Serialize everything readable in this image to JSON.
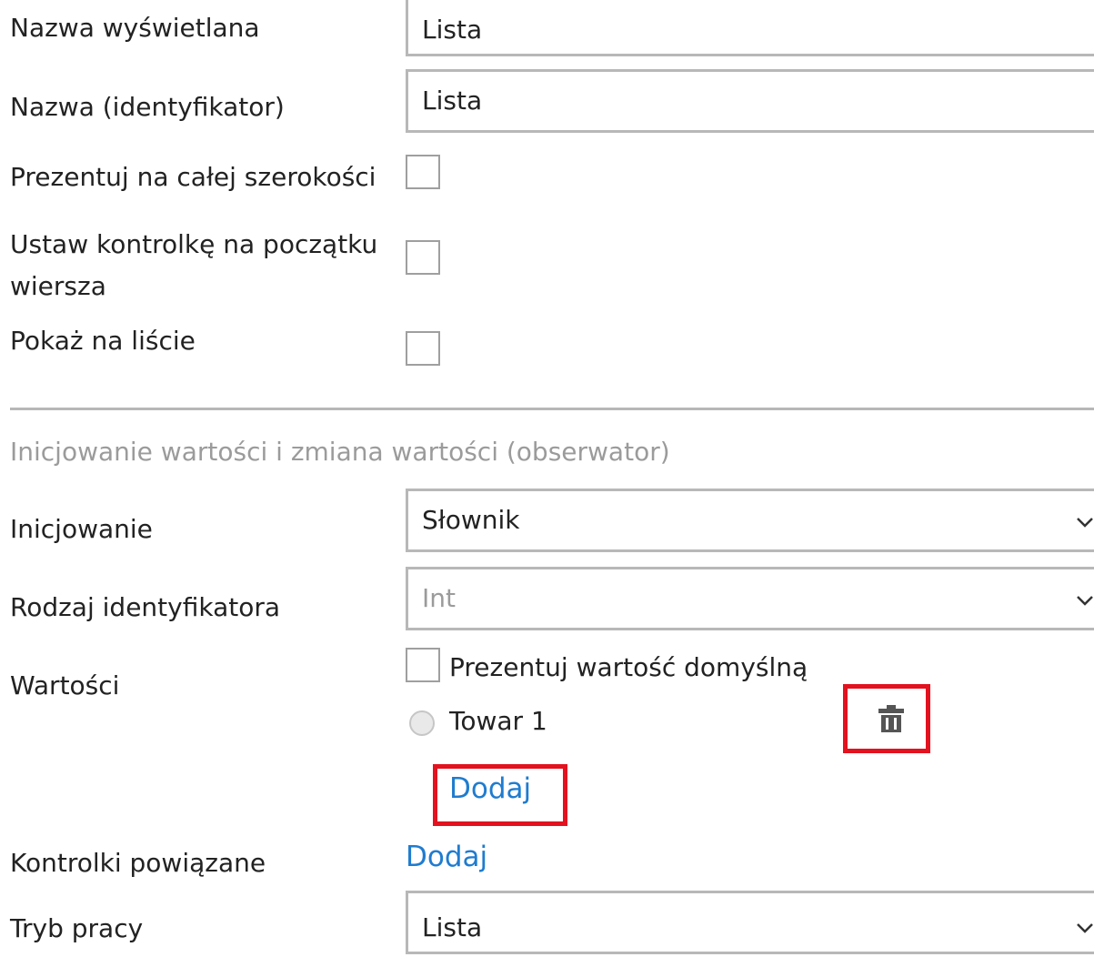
{
  "fields": {
    "display_name": {
      "label": "Nazwa wyświetlana",
      "value": "Lista"
    },
    "identifier": {
      "label": "Nazwa (identyfikator)",
      "value": "Lista"
    },
    "full_width": {
      "label": "Prezentuj na całej szerokości",
      "checked": false
    },
    "row_start": {
      "label": "Ustaw kontrolkę na początku wiersza",
      "checked": false
    },
    "show_on_list": {
      "label": "Pokaż na liście",
      "checked": false
    }
  },
  "section": {
    "title": "Inicjowanie wartości i zmiana wartości (obserwator)",
    "init": {
      "label": "Inicjowanie",
      "value": "Słownik"
    },
    "id_type": {
      "label": "Rodzaj identyfikatora",
      "value": "Int"
    },
    "values": {
      "label": "Wartości",
      "show_default_label": "Prezentuj wartość domyślną",
      "show_default_checked": false,
      "items": [
        {
          "label": "Towar 1",
          "selected": false,
          "icon": "trash-icon"
        }
      ],
      "add_label": "Dodaj"
    },
    "related": {
      "label": "Kontrolki powiązane",
      "add_label": "Dodaj"
    },
    "mode": {
      "label": "Tryb pracy",
      "value": "Lista"
    }
  },
  "colors": {
    "link": "#1f7ccf",
    "highlight": "#e3121e",
    "border": "#b8b8b8",
    "muted_text": "#9b9b9b"
  }
}
